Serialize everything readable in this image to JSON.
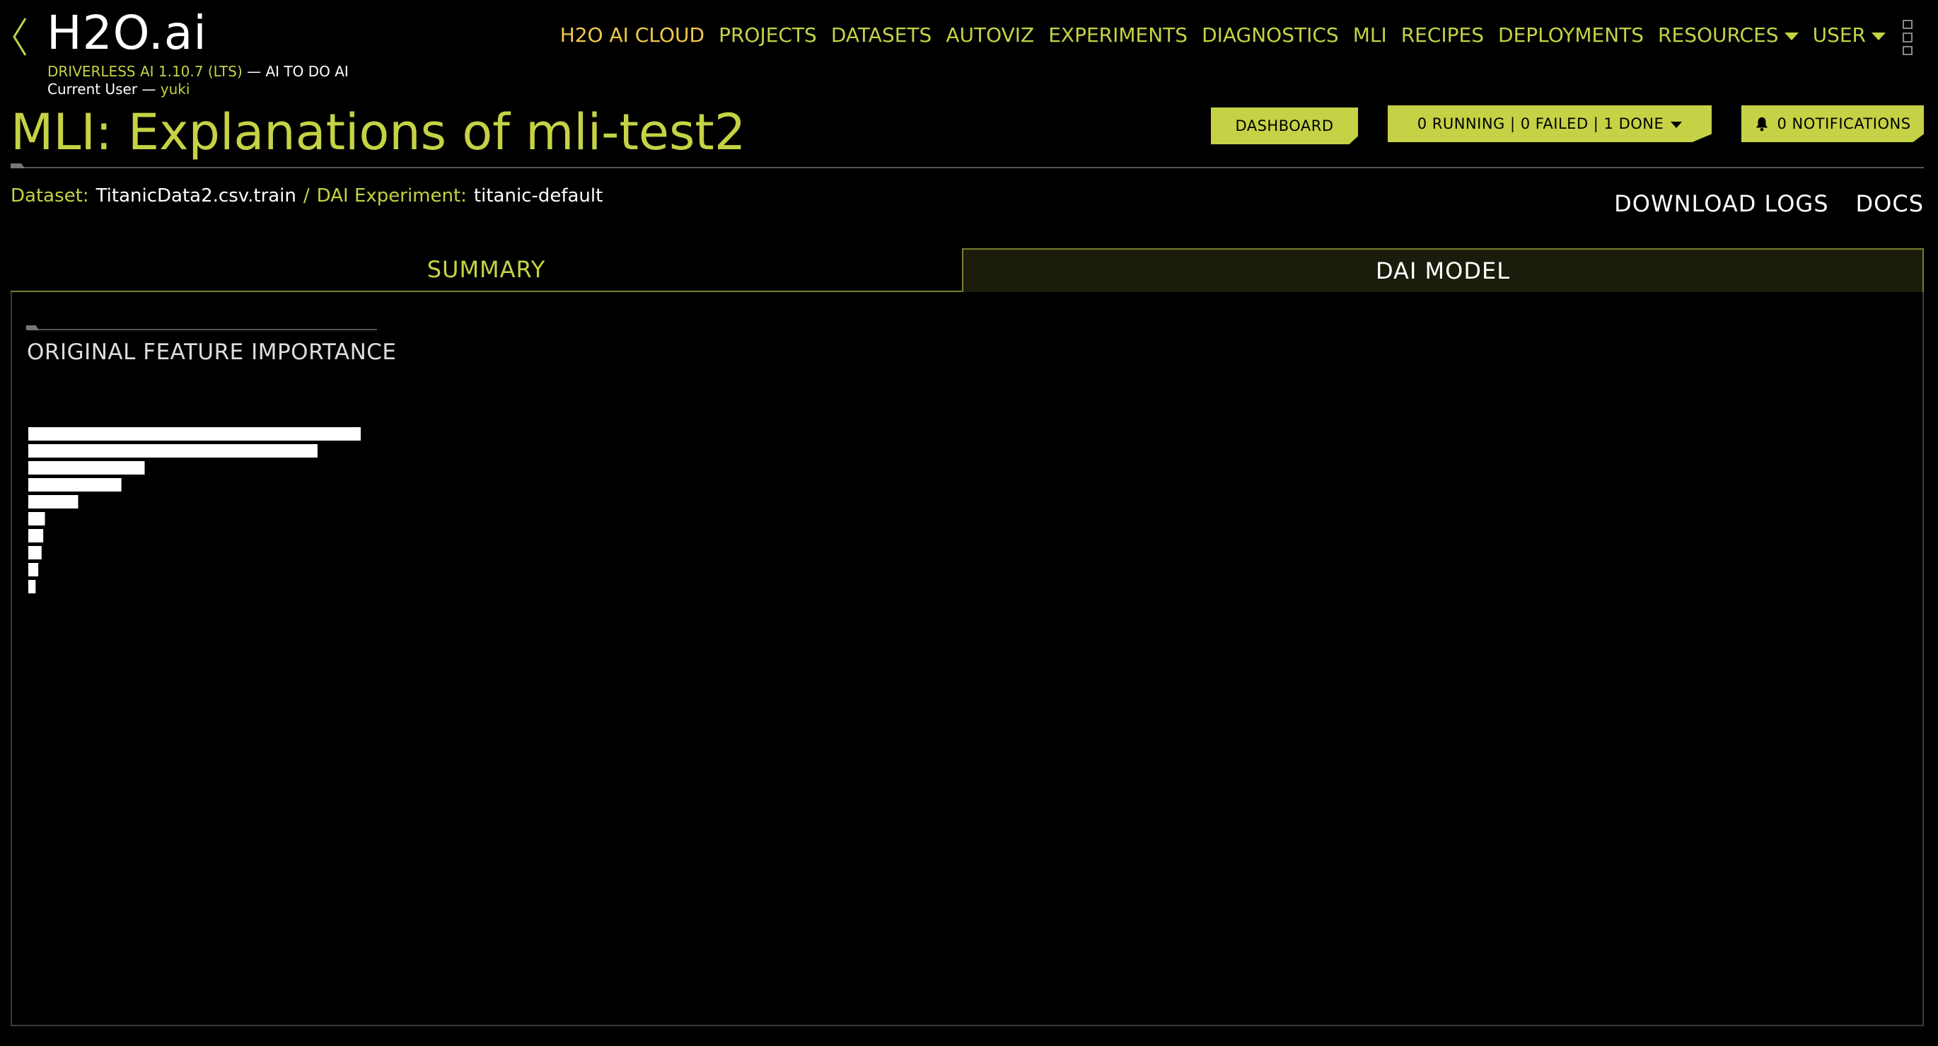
{
  "header": {
    "brand": "H2O.ai",
    "version_label": "DRIVERLESS AI 1.10.7 (LTS)",
    "tagline": " — AI TO DO AI",
    "user_prefix": "Current User — ",
    "user_name": "yuki"
  },
  "nav": [
    {
      "label": "H2O AI CLOUD",
      "active": true
    },
    {
      "label": "PROJECTS"
    },
    {
      "label": "DATASETS"
    },
    {
      "label": "AUTOVIZ"
    },
    {
      "label": "EXPERIMENTS"
    },
    {
      "label": "DIAGNOSTICS"
    },
    {
      "label": "MLI"
    },
    {
      "label": "RECIPES"
    },
    {
      "label": "DEPLOYMENTS"
    },
    {
      "label": "RESOURCES",
      "dropdown": true
    },
    {
      "label": "USER",
      "dropdown": true
    }
  ],
  "page": {
    "title": "MLI: Explanations of mli-test2",
    "dashboard_button": "DASHBOARD",
    "status_button": "0 RUNNING | 0 FAILED | 1 DONE",
    "notifications_button": "0 NOTIFICATIONS"
  },
  "breadcrumb": {
    "dataset_label": "Dataset:",
    "dataset_value": "TitanicData2.csv.train",
    "separator": "/",
    "experiment_label": "DAI Experiment:",
    "experiment_value": "titanic-default"
  },
  "links": {
    "download_logs": "DOWNLOAD LOGS",
    "docs": "DOCS"
  },
  "tabs": {
    "summary": "SUMMARY",
    "dai_model": "DAI MODEL",
    "active": "dai_model"
  },
  "section": {
    "title": "ORIGINAL FEATURE IMPORTANCE"
  },
  "colors": {
    "accent": "#c5d245",
    "active_nav": "#f2c94c",
    "background": "#000000",
    "bar": "#ffffff"
  },
  "chart_data": {
    "type": "bar",
    "orientation": "horizontal",
    "categories": [],
    "values": [
      1.0,
      0.87,
      0.35,
      0.28,
      0.15,
      0.05,
      0.045,
      0.04,
      0.03,
      0.022
    ],
    "title": "",
    "xlabel": "",
    "ylabel": ""
  }
}
